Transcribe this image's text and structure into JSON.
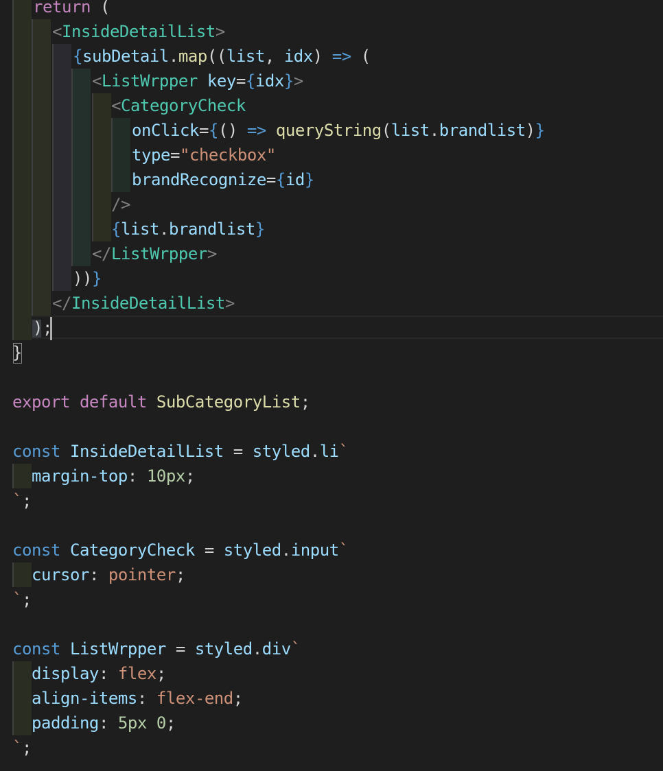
{
  "editor": {
    "language": "javascript-jsx",
    "theme": "dark",
    "cursor_line": 13,
    "lines": [
      {
        "tokens": [
          [
            "t-ctl",
            "return"
          ],
          [
            "t-plain",
            " "
          ],
          [
            "t-paren",
            "("
          ]
        ]
      },
      {
        "tokens": [
          [
            "t-punct",
            "<"
          ],
          [
            "t-tag",
            "InsideDetailList"
          ],
          [
            "t-punct",
            ">"
          ]
        ]
      },
      {
        "tokens": [
          [
            "t-brace",
            "{"
          ],
          [
            "t-var",
            "subDetail"
          ],
          [
            "t-plain",
            "."
          ],
          [
            "t-fn",
            "map"
          ],
          [
            "t-paren",
            "(("
          ],
          [
            "t-var",
            "list"
          ],
          [
            "t-plain",
            ", "
          ],
          [
            "t-var",
            "idx"
          ],
          [
            "t-paren",
            ")"
          ],
          [
            "t-plain",
            " "
          ],
          [
            "t-arrow",
            "=>"
          ],
          [
            "t-plain",
            " "
          ],
          [
            "t-paren",
            "("
          ]
        ]
      },
      {
        "tokens": [
          [
            "t-punct",
            "<"
          ],
          [
            "t-tag",
            "ListWrpper"
          ],
          [
            "t-plain",
            " "
          ],
          [
            "t-attr",
            "key"
          ],
          [
            "t-plain",
            "="
          ],
          [
            "t-brace",
            "{"
          ],
          [
            "t-var",
            "idx"
          ],
          [
            "t-brace",
            "}"
          ],
          [
            "t-punct",
            ">"
          ]
        ]
      },
      {
        "tokens": [
          [
            "t-punct",
            "<"
          ],
          [
            "t-tag",
            "CategoryCheck"
          ]
        ]
      },
      {
        "tokens": [
          [
            "t-attr",
            "onClick"
          ],
          [
            "t-plain",
            "="
          ],
          [
            "t-brace",
            "{"
          ],
          [
            "t-paren",
            "()"
          ],
          [
            "t-plain",
            " "
          ],
          [
            "t-arrow",
            "=>"
          ],
          [
            "t-plain",
            " "
          ],
          [
            "t-fn",
            "queryString"
          ],
          [
            "t-paren",
            "("
          ],
          [
            "t-var",
            "list"
          ],
          [
            "t-plain",
            "."
          ],
          [
            "t-var",
            "brandlist"
          ],
          [
            "t-paren",
            ")"
          ],
          [
            "t-brace",
            "}"
          ]
        ]
      },
      {
        "tokens": [
          [
            "t-attr",
            "type"
          ],
          [
            "t-plain",
            "="
          ],
          [
            "t-str",
            "\"checkbox\""
          ]
        ]
      },
      {
        "tokens": [
          [
            "t-attr",
            "brandRecognize"
          ],
          [
            "t-plain",
            "="
          ],
          [
            "t-brace",
            "{"
          ],
          [
            "t-var",
            "id"
          ],
          [
            "t-brace",
            "}"
          ]
        ]
      },
      {
        "tokens": [
          [
            "t-punct",
            "/>"
          ]
        ]
      },
      {
        "tokens": [
          [
            "t-brace",
            "{"
          ],
          [
            "t-var",
            "list"
          ],
          [
            "t-plain",
            "."
          ],
          [
            "t-var",
            "brandlist"
          ],
          [
            "t-brace",
            "}"
          ]
        ]
      },
      {
        "tokens": [
          [
            "t-punct",
            "</"
          ],
          [
            "t-tag",
            "ListWrpper"
          ],
          [
            "t-punct",
            ">"
          ]
        ]
      },
      {
        "tokens": [
          [
            "t-paren",
            "))"
          ],
          [
            "t-brace",
            "}"
          ]
        ]
      },
      {
        "tokens": [
          [
            "t-punct",
            "</"
          ],
          [
            "t-tag",
            "InsideDetailList"
          ],
          [
            "t-punct",
            ">"
          ]
        ]
      },
      {
        "tokens": [
          [
            "t-paren",
            ")"
          ],
          [
            "t-plain",
            ";"
          ]
        ]
      },
      {
        "tokens": [
          [
            "t-plain",
            "}"
          ]
        ]
      },
      {
        "tokens": []
      },
      {
        "tokens": [
          [
            "t-kw",
            "export"
          ],
          [
            "t-plain",
            " "
          ],
          [
            "t-kw",
            "default"
          ],
          [
            "t-plain",
            " "
          ],
          [
            "t-fn",
            "SubCategoryList"
          ],
          [
            "t-plain",
            ";"
          ]
        ]
      },
      {
        "tokens": []
      },
      {
        "tokens": [
          [
            "t-st",
            "const"
          ],
          [
            "t-plain",
            " "
          ],
          [
            "t-var",
            "InsideDetailList"
          ],
          [
            "t-plain",
            " = "
          ],
          [
            "t-var",
            "styled"
          ],
          [
            "t-plain",
            "."
          ],
          [
            "t-var",
            "li"
          ],
          [
            "t-tick",
            "`"
          ]
        ]
      },
      {
        "tokens": [
          [
            "t-attr",
            "margin-top"
          ],
          [
            "t-plain",
            ": "
          ],
          [
            "t-num",
            "10px"
          ],
          [
            "t-plain",
            ";"
          ]
        ]
      },
      {
        "tokens": [
          [
            "t-tick",
            "`"
          ],
          [
            "t-plain",
            ";"
          ]
        ]
      },
      {
        "tokens": []
      },
      {
        "tokens": [
          [
            "t-st",
            "const"
          ],
          [
            "t-plain",
            " "
          ],
          [
            "t-var",
            "CategoryCheck"
          ],
          [
            "t-plain",
            " = "
          ],
          [
            "t-var",
            "styled"
          ],
          [
            "t-plain",
            "."
          ],
          [
            "t-var",
            "input"
          ],
          [
            "t-tick",
            "`"
          ]
        ]
      },
      {
        "tokens": [
          [
            "t-attr",
            "cursor"
          ],
          [
            "t-plain",
            ": "
          ],
          [
            "t-str",
            "pointer"
          ],
          [
            "t-plain",
            ";"
          ]
        ]
      },
      {
        "tokens": [
          [
            "t-tick",
            "`"
          ],
          [
            "t-plain",
            ";"
          ]
        ]
      },
      {
        "tokens": []
      },
      {
        "tokens": [
          [
            "t-st",
            "const"
          ],
          [
            "t-plain",
            " "
          ],
          [
            "t-var",
            "ListWrpper"
          ],
          [
            "t-plain",
            " = "
          ],
          [
            "t-var",
            "styled"
          ],
          [
            "t-plain",
            "."
          ],
          [
            "t-var",
            "div"
          ],
          [
            "t-tick",
            "`"
          ]
        ]
      },
      {
        "tokens": [
          [
            "t-attr",
            "display"
          ],
          [
            "t-plain",
            ": "
          ],
          [
            "t-str",
            "flex"
          ],
          [
            "t-plain",
            ";"
          ]
        ]
      },
      {
        "tokens": [
          [
            "t-attr",
            "align-items"
          ],
          [
            "t-plain",
            ": "
          ],
          [
            "t-str",
            "flex-end"
          ],
          [
            "t-plain",
            ";"
          ]
        ]
      },
      {
        "tokens": [
          [
            "t-attr",
            "padding"
          ],
          [
            "t-plain",
            ": "
          ],
          [
            "t-num",
            "5px 0"
          ],
          [
            "t-plain",
            ";"
          ]
        ]
      },
      {
        "tokens": [
          [
            "t-tick",
            "`"
          ],
          [
            "t-plain",
            ";"
          ]
        ]
      }
    ]
  }
}
